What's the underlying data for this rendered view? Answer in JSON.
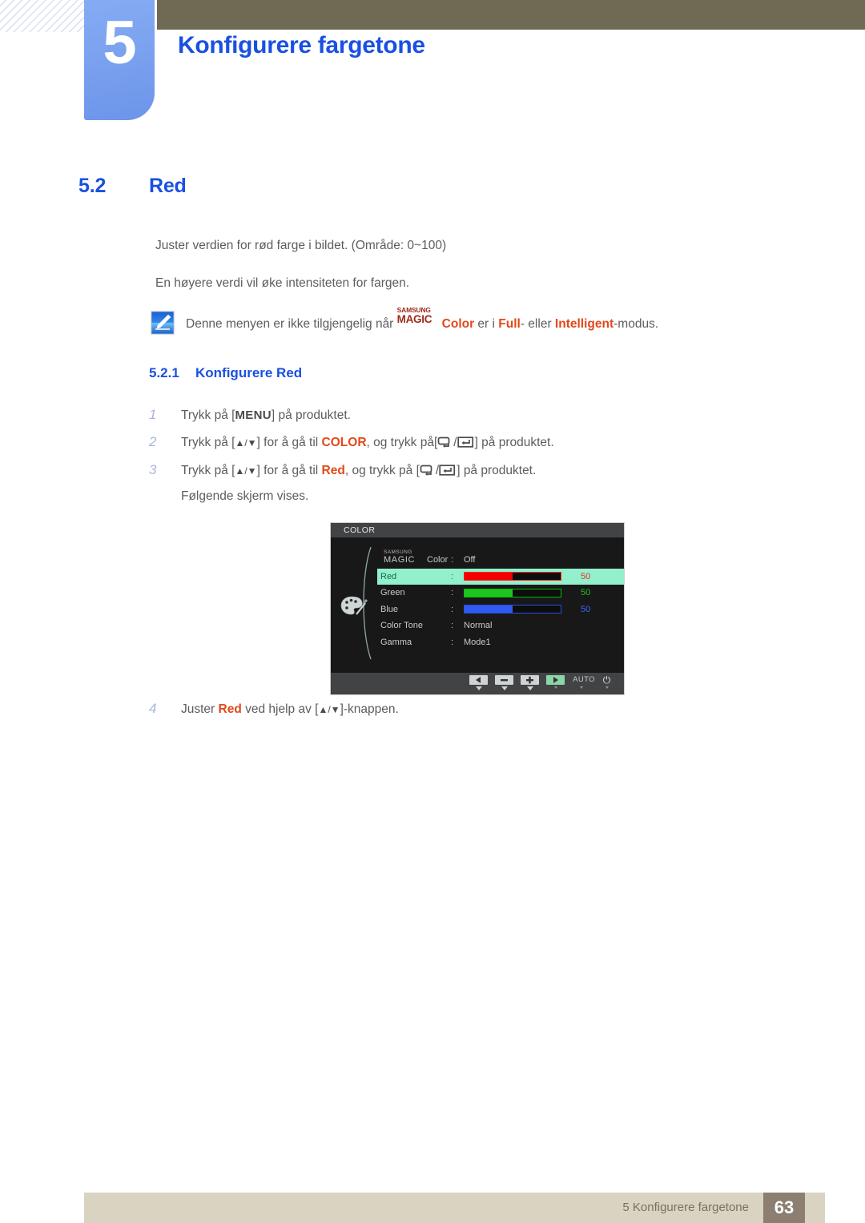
{
  "header": {
    "chapter_number": "5",
    "chapter_title": "Konfigurere fargetone"
  },
  "section": {
    "number": "5.2",
    "title": "Red"
  },
  "body": {
    "para_1": "Juster verdien for rød farge i bildet. (Område: 0~100)",
    "para_2": "En høyere verdi vil øke intensiteten for fargen."
  },
  "note": {
    "icon": "note-pencil-icon",
    "text_before": "Denne menyen er ikke tilgjengelig når ",
    "magic_samsung": "SAMSUNG",
    "magic_magic": "MAGIC",
    "magic_color": "Color",
    "text_mid": " er i ",
    "emphasis_1": "Full",
    "text_mid_2": "- eller ",
    "emphasis_2": "Intelligent",
    "text_after": "-modus."
  },
  "subsection": {
    "number": "5.2.1",
    "title": "Konfigurere Red"
  },
  "steps": [
    {
      "num": "1",
      "text_a": "Trykk på [",
      "key": "MENU",
      "text_b": "] på produktet."
    },
    {
      "num": "2",
      "text_a": "Trykk på [",
      "arrows": "▲/▼",
      "text_b": "] for å gå til ",
      "emphasis": "COLOR",
      "text_c": ", og trykk på[",
      "text_d": "] på produktet."
    },
    {
      "num": "3",
      "text_a": "Trykk på [",
      "arrows": "▲/▼",
      "text_b": "] for å gå til ",
      "emphasis": "Red",
      "text_c": ", og trykk på [",
      "text_d": "] på produktet."
    },
    {
      "num": "",
      "text_a": "Følgende skjerm vises."
    },
    {
      "num": "4",
      "text_a": "Juster ",
      "emphasis": "Red",
      "text_b": " ved hjelp av [",
      "arrows": "▲/▼",
      "text_c": "]-knappen."
    }
  ],
  "osd": {
    "title": "COLOR",
    "palette_icon": "palette-icon",
    "rows": [
      {
        "label_samsung": "SAMSUNG",
        "label_magic": "MAGIC",
        "label_color": "Color",
        "colon": ":",
        "value": "Off",
        "type": "text",
        "highlighted": false
      },
      {
        "label": "Red",
        "colon": ":",
        "value": "50",
        "type": "bar",
        "bar_percent": 50,
        "bar_color": "#f20000",
        "highlighted": true
      },
      {
        "label": "Green",
        "colon": ":",
        "value": "50",
        "type": "bar",
        "bar_percent": 50,
        "bar_color": "#1fc41f",
        "highlighted": false
      },
      {
        "label": "Blue",
        "colon": ":",
        "value": "50",
        "type": "bar",
        "bar_percent": 50,
        "bar_color": "#2e5bf0",
        "highlighted": false
      },
      {
        "label": "Color Tone",
        "colon": ":",
        "value": "Normal",
        "type": "text",
        "highlighted": false
      },
      {
        "label": "Gamma",
        "colon": ":",
        "value": "Mode1",
        "type": "text",
        "highlighted": false
      }
    ],
    "buttons": [
      {
        "name": "left-arrow-button",
        "label": ""
      },
      {
        "name": "minus-button",
        "label": ""
      },
      {
        "name": "plus-button",
        "label": ""
      },
      {
        "name": "right-arrow-button",
        "label": ""
      },
      {
        "name": "auto-button",
        "label": "AUTO"
      },
      {
        "name": "power-button",
        "label": "⏻"
      }
    ],
    "highlight_color": "#92f0cc"
  },
  "footer": {
    "text": "5 Konfigurere fargetone",
    "page_number": "63"
  },
  "colors": {
    "heading_blue": "#1a50e2",
    "accent_orange": "#e2481a",
    "olive_band": "#6e6a54",
    "footer_band": "#d9d3c1",
    "page_box": "#8c7f72"
  }
}
